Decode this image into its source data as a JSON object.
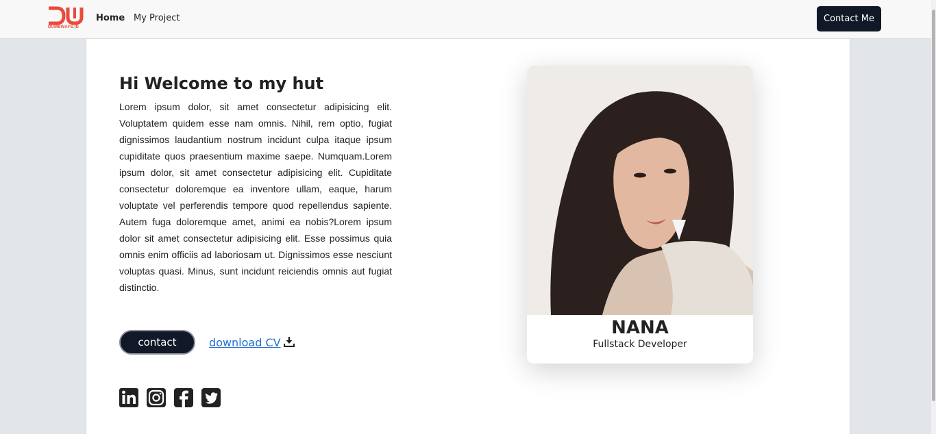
{
  "brand": {
    "logo_text": "DUMBWAYS.ID",
    "color": "#e94a3c"
  },
  "nav": {
    "items": [
      {
        "label": "Home",
        "active": true
      },
      {
        "label": "My Project",
        "active": false
      }
    ],
    "cta_label": "Contact Me"
  },
  "hero": {
    "title": "Hi Welcome to my hut",
    "body": "Lorem ipsum dolor, sit amet consectetur adipisicing elit. Voluptatem quidem esse nam omnis. Nihil, rem optio, fugiat dignissimos laudantium nostrum incidunt culpa itaque ipsum cupiditate quos praesentium maxime saepe. Numquam.Lorem ipsum dolor, sit amet consectetur adipisicing elit. Cupiditate consectetur doloremque ea inventore ullam, eaque, harum voluptate vel perferendis tempore quod repellendus sapiente. Autem fuga doloremque amet, animi ea nobis?Lorem ipsum dolor sit amet consectetur adipisicing elit. Esse possimus quia omnis enim officiis ad laboriosam ut. Dignissimos esse nesciunt voluptas quasi. Minus, sunt incidunt reiciendis omnis aut fugiat distinctio.",
    "contact_label": "contact",
    "download_label": "download CV",
    "download_icon": "download-icon"
  },
  "social": [
    {
      "name": "linkedin",
      "icon": "linkedin-icon"
    },
    {
      "name": "instagram",
      "icon": "instagram-icon"
    },
    {
      "name": "facebook",
      "icon": "facebook-icon"
    },
    {
      "name": "twitter",
      "icon": "twitter-icon"
    }
  ],
  "profile": {
    "name": "NANA",
    "role": "Fullstack Developer"
  },
  "colors": {
    "dark_button": "#111827",
    "link": "#1e6fd0",
    "page_bg": "#e2e5ea"
  }
}
